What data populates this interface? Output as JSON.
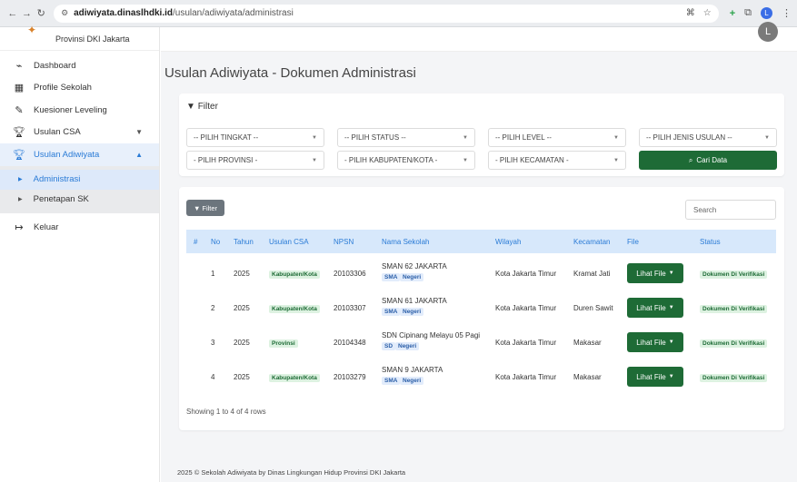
{
  "browser": {
    "url_host": "adiwiyata.dinaslhdki.id",
    "url_path": "/usulan/adiwiyata/administrasi",
    "profile_initial": "L"
  },
  "sidebar": {
    "brand": "Provinsi DKI Jakarta",
    "items": [
      {
        "label": "Dashboard",
        "icon": "chart-icon"
      },
      {
        "label": "Profile Sekolah",
        "icon": "building-icon"
      },
      {
        "label": "Kuesioner Leveling",
        "icon": "edit-icon"
      },
      {
        "label": "Usulan CSA",
        "icon": "trophy-icon"
      },
      {
        "label": "Usulan Adiwiyata",
        "icon": "trophy-icon"
      }
    ],
    "submenu": [
      {
        "label": "Administrasi"
      },
      {
        "label": "Penetapan SK"
      }
    ],
    "logout": "Keluar"
  },
  "main": {
    "title": "Usulan Adiwiyata - Dokumen Administrasi",
    "avatar_initial": "L",
    "filter": {
      "heading": "Filter",
      "tingkat": "-- PILIH TINGKAT --",
      "status": "-- PILIH STATUS --",
      "level": "-- PILIH LEVEL --",
      "jenis": "-- PILIH JENIS USULAN --",
      "provinsi": "- PILIH PROVINSI -",
      "kabupaten": "- PILIH KABUPATEN/KOTA -",
      "kecamatan": "- PILIH KECAMATAN -",
      "cari": "Cari Data"
    },
    "table": {
      "filter_btn": "Filter",
      "search_placeholder": "Search",
      "headers": [
        "#",
        "No",
        "Tahun",
        "Usulan CSA",
        "NPSN",
        "Nama Sekolah",
        "Wilayah",
        "Kecamatan",
        "File",
        "Status"
      ],
      "rows": [
        {
          "no": "1",
          "tahun": "2025",
          "usulan": "Kabupaten/Kota",
          "npsn": "20103306",
          "nama": "SMAN 62 JAKARTA",
          "jenjang": "SMA",
          "tipe": "Negeri",
          "wilayah": "Kota Jakarta Timur",
          "kecamatan": "Kramat Jati",
          "file": "Lihat File",
          "status": "Dokumen Di Verifikasi"
        },
        {
          "no": "2",
          "tahun": "2025",
          "usulan": "Kabupaten/Kota",
          "npsn": "20103307",
          "nama": "SMAN 61 JAKARTA",
          "jenjang": "SMA",
          "tipe": "Negeri",
          "wilayah": "Kota Jakarta Timur",
          "kecamatan": "Duren Sawit",
          "file": "Lihat File",
          "status": "Dokumen Di Verifikasi"
        },
        {
          "no": "3",
          "tahun": "2025",
          "usulan": "Provinsi",
          "npsn": "20104348",
          "nama": "SDN Cipinang Melayu 05 Pagi",
          "jenjang": "SD",
          "tipe": "Negeri",
          "wilayah": "Kota Jakarta Timur",
          "kecamatan": "Makasar",
          "file": "Lihat File",
          "status": "Dokumen Di Verifikasi"
        },
        {
          "no": "4",
          "tahun": "2025",
          "usulan": "Kabupaten/Kota",
          "npsn": "20103279",
          "nama": "SMAN 9 JAKARTA",
          "jenjang": "SMA",
          "tipe": "Negeri",
          "wilayah": "Kota Jakarta Timur",
          "kecamatan": "Makasar",
          "file": "Lihat File",
          "status": "Dokumen Di Verifikasi"
        }
      ],
      "showing": "Showing 1 to 4 of 4 rows"
    },
    "footer": "2025 © Sekolah Adiwiyata by Dinas Lingkungan Hidup Provinsi DKI Jakarta"
  }
}
